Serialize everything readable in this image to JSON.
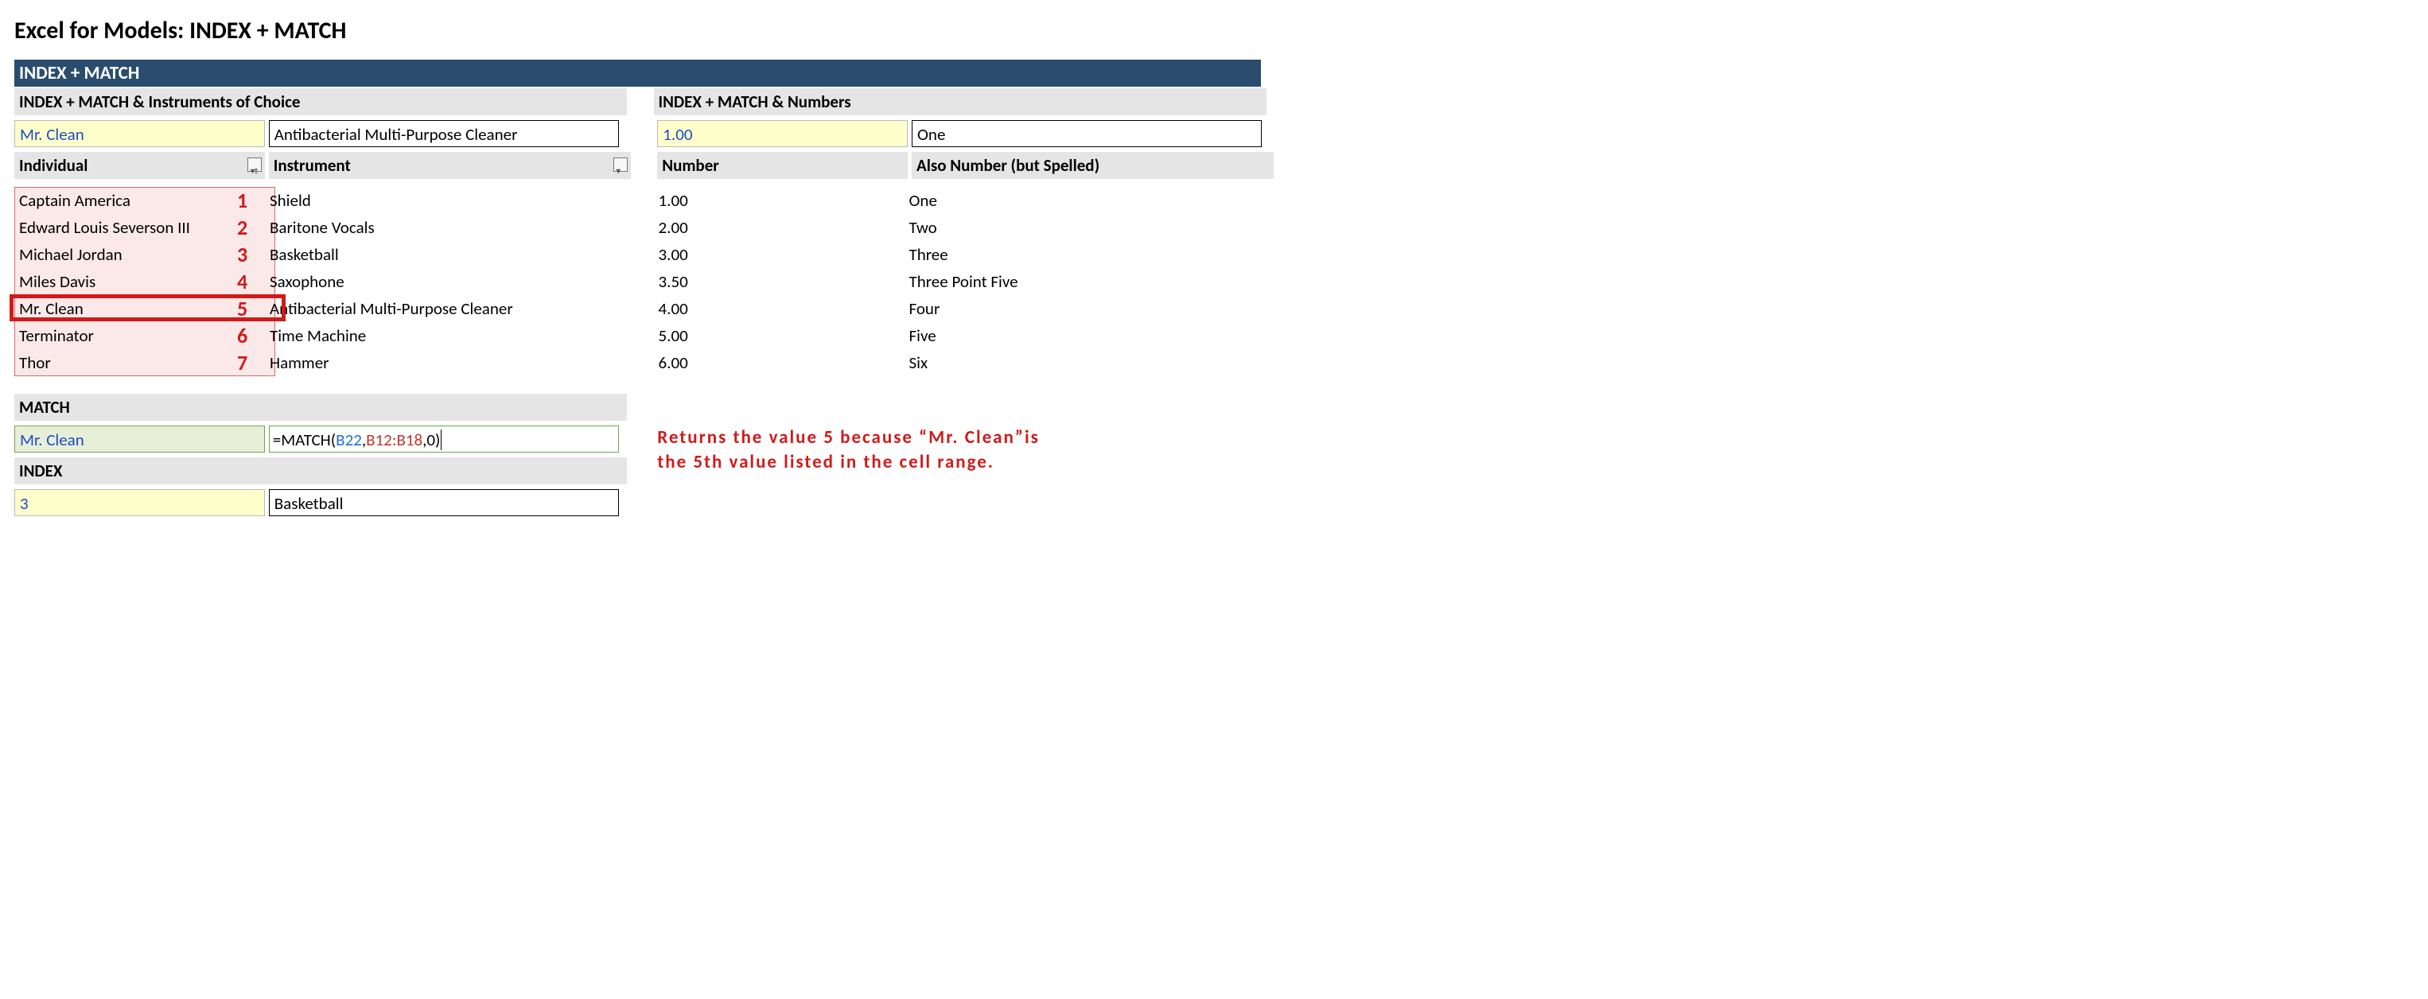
{
  "title": "Excel for Models: INDEX + MATCH",
  "section_header": "INDEX + MATCH",
  "left": {
    "heading": "INDEX + MATCH & Instruments of Choice",
    "lookup_key": "Mr. Clean",
    "lookup_result": "Antibacterial Multi-Purpose Cleaner",
    "col1_header": "Individual",
    "col2_header": "Instrument",
    "rows": [
      {
        "n": "1",
        "individual": "Captain America",
        "instrument": "Shield"
      },
      {
        "n": "2",
        "individual": "Edward Louis Severson III",
        "instrument": "Baritone Vocals"
      },
      {
        "n": "3",
        "individual": "Michael Jordan",
        "instrument": "Basketball"
      },
      {
        "n": "4",
        "individual": "Miles Davis",
        "instrument": "Saxophone"
      },
      {
        "n": "5",
        "individual": "Mr. Clean",
        "instrument": "Antibacterial Multi-Purpose Cleaner"
      },
      {
        "n": "6",
        "individual": "Terminator",
        "instrument": "Time Machine"
      },
      {
        "n": "7",
        "individual": "Thor",
        "instrument": "Hammer"
      }
    ],
    "highlight_row_index": 4
  },
  "right": {
    "heading": "INDEX + MATCH & Numbers",
    "lookup_key": "1.00",
    "lookup_result": "One",
    "col1_header": "Number",
    "col2_header": "Also Number (but Spelled)",
    "rows": [
      {
        "number": "1.00",
        "spelled": "One"
      },
      {
        "number": "2.00",
        "spelled": "Two"
      },
      {
        "number": "3.00",
        "spelled": "Three"
      },
      {
        "number": "3.50",
        "spelled": "Three Point Five"
      },
      {
        "number": "4.00",
        "spelled": "Four"
      },
      {
        "number": "5.00",
        "spelled": "Five"
      },
      {
        "number": "6.00",
        "spelled": "Six"
      }
    ]
  },
  "match": {
    "heading": "MATCH",
    "lookup_key": "Mr. Clean",
    "formula": {
      "pre": "=MATCH(",
      "arg1": "B22",
      "sep1": ",",
      "arg2": "B12:B18",
      "post": ",0)"
    }
  },
  "index": {
    "heading": "INDEX",
    "lookup_key": "3",
    "result": "Basketball"
  },
  "note": {
    "line1": "Returns the value 5 because “Mr. Clean”is",
    "line2": "the 5th value listed in the cell range."
  }
}
